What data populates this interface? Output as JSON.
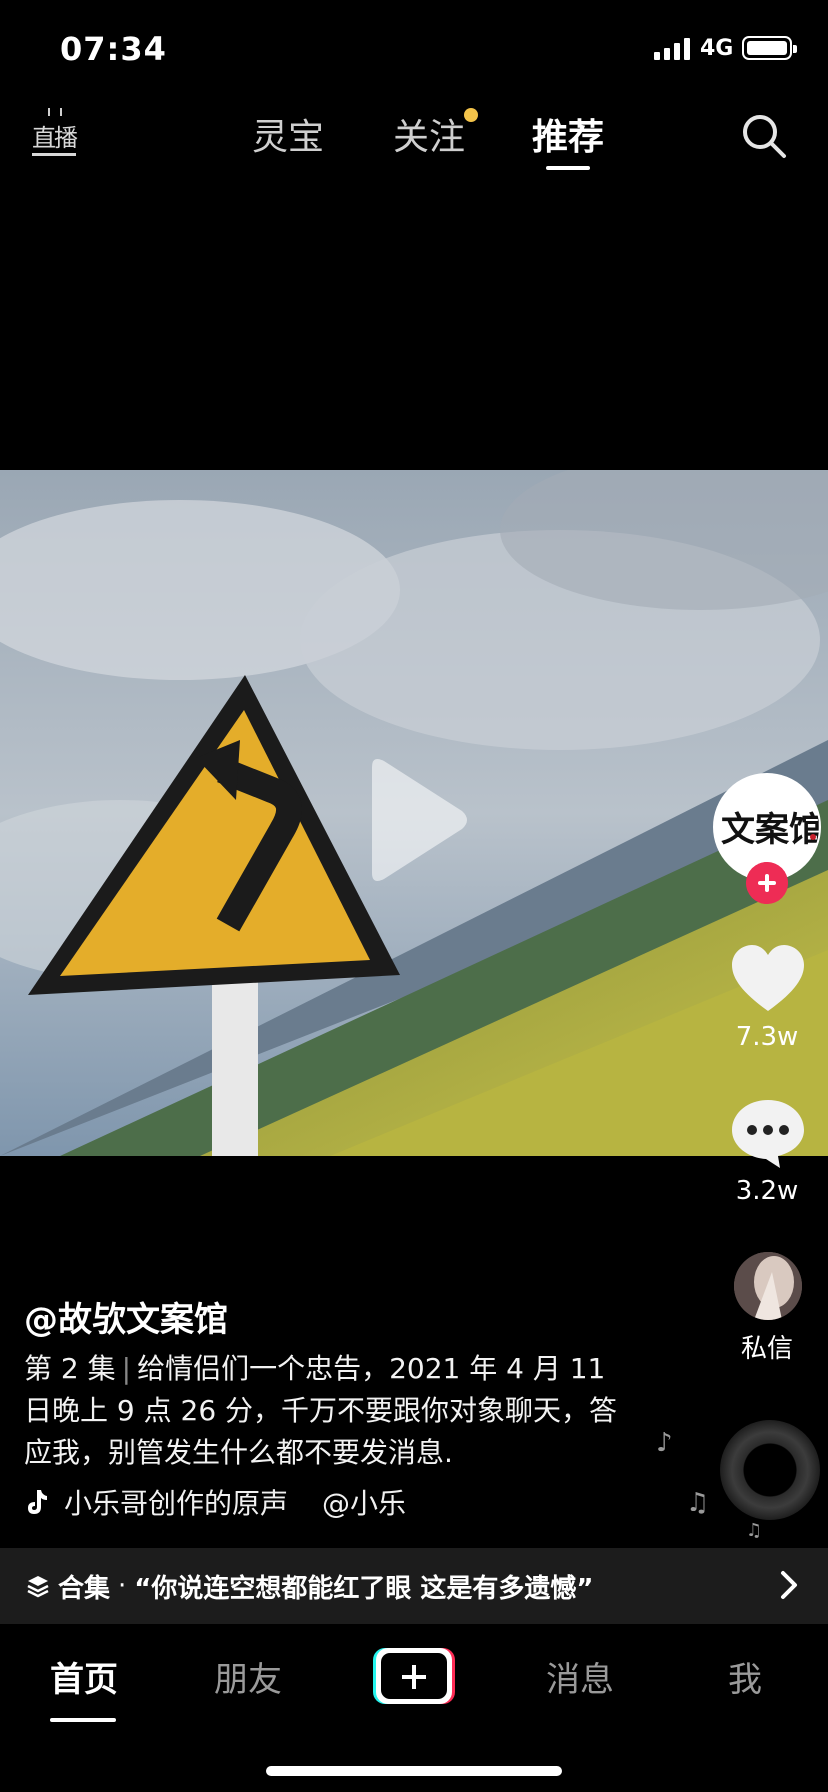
{
  "status_bar": {
    "time": "07:34",
    "network": "4G"
  },
  "top_nav": {
    "live_label": "直播",
    "tabs": [
      {
        "label": "灵宝"
      },
      {
        "label": "关注"
      },
      {
        "label": "推荐"
      }
    ],
    "active_tab": "推荐",
    "follow_dot_color": "#f3c34a"
  },
  "video": {
    "state": "paused"
  },
  "creator": {
    "avatar_text": "文案馆",
    "follow_color": "#ee2c55"
  },
  "actions": {
    "like_count": "7.3w",
    "comment_count": "3.2w",
    "dm_label": "私信"
  },
  "caption": {
    "author": "@故欤文案馆",
    "episode": "第 2 集",
    "text": "给情侣们一个忠告，2021 年 4 月 11 日晚上 9 点 26 分，千万不要跟你对象聊天，答应我，别管发生什么都不要发消息.",
    "music_title": "小乐哥创作的原声",
    "music_creator": "@小乐"
  },
  "collection": {
    "label": "合集",
    "separator": "·",
    "title": "“你说连空想都能红了眼 这是有多遗憾”"
  },
  "tab_bar": {
    "home": "首页",
    "friends": "朋友",
    "messages": "消息",
    "me": "我"
  },
  "colors": {
    "background": "#000000",
    "accent_red": "#fe2c55",
    "accent_cyan": "#25f4ee"
  }
}
